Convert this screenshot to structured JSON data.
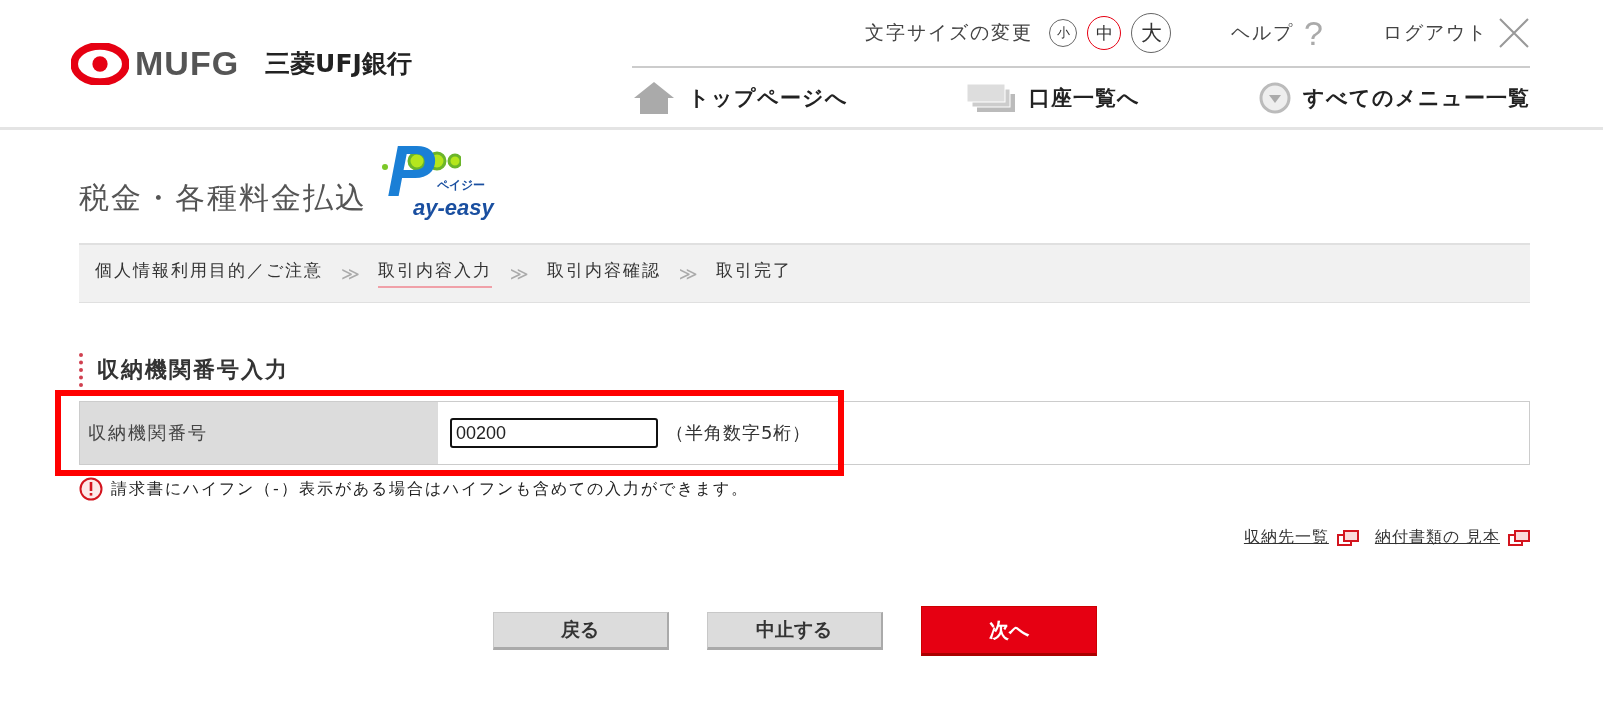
{
  "header": {
    "logo": {
      "mark": "MUFG",
      "bank_name": "三菱UFJ銀行"
    },
    "font_size": {
      "label": "文字サイズの変更",
      "options": [
        {
          "label": "小",
          "kind": "small",
          "selected": false
        },
        {
          "label": "中",
          "kind": "medium",
          "selected": true
        },
        {
          "label": "大",
          "kind": "large",
          "selected": false
        }
      ]
    },
    "help": {
      "label": "ヘルプ",
      "icon": "?"
    },
    "logout": {
      "label": "ログアウト"
    },
    "nav": [
      {
        "kind": "home",
        "label": "トップページへ"
      },
      {
        "kind": "accounts",
        "label": "口座一覧へ"
      },
      {
        "kind": "menu",
        "label": "すべてのメニュー一覧"
      }
    ]
  },
  "page_title": "税金・各種料金払込",
  "pay_easy_logo": {
    "initial": "P",
    "rest": "ay-easy",
    "kana": "ペイジー"
  },
  "steps": [
    {
      "label": "個人情報利用目的／ご注意",
      "selected": false,
      "separator": "≫"
    },
    {
      "label": "取引内容入力",
      "selected": true,
      "separator": "≫"
    },
    {
      "label": "取引内容確認",
      "selected": false,
      "separator": "≫"
    },
    {
      "label": "取引完了",
      "selected": false
    }
  ],
  "section_title": "収納機関番号入力",
  "form": {
    "label": "収納機関番号",
    "value": "00200",
    "hint": "（半角数字5桁）"
  },
  "notice": "請求書にハイフン（-）表示がある場合はハイフンも含めての入力ができます。",
  "links": [
    "収納先一覧",
    "納付書類の 見本"
  ],
  "buttons": [
    {
      "kind": "secondary",
      "label": "戻る"
    },
    {
      "kind": "secondary",
      "label": "中止する"
    },
    {
      "kind": "primary",
      "label": "次へ"
    }
  ]
}
